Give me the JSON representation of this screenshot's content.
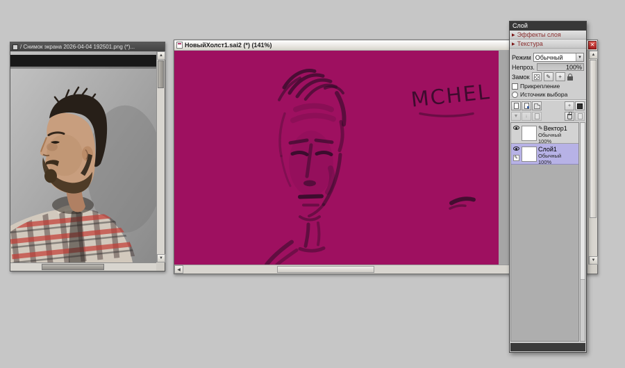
{
  "desktop": {
    "bg_color": "#c6c6c6"
  },
  "icons": {
    "close": "✕",
    "up": "▲",
    "down": "▼",
    "left": "◀",
    "right": "▶",
    "expander": "▶",
    "dropdown": "▼",
    "pen": "✎",
    "move": "+",
    "merge_down": "▼",
    "transfer_down": "↓"
  },
  "reference_window": {
    "title": "/ Снимок экрана 2026-04-04 192501.png (*)..."
  },
  "canvas_window": {
    "title": "НовыйХолст1.sai2 (*) (141%)",
    "zoom": "141%",
    "canvas_color": "#9e1060",
    "sketch_text": "MCHEL"
  },
  "layer_panel": {
    "title": "Слой",
    "sections": [
      {
        "label": "Эффекты слоя"
      },
      {
        "label": "Текстура"
      }
    ],
    "mode": {
      "label": "Режим",
      "value": "Обычный"
    },
    "opacity": {
      "label": "Непроз.",
      "value": "100%"
    },
    "lock": {
      "label": "Замок"
    },
    "clipping": {
      "label": "Прикрепление",
      "checked": false
    },
    "selection_source": {
      "label": "Источник выбора",
      "checked": false
    },
    "layers": [
      {
        "name": "Вектор1",
        "mode": "Обычный",
        "opacity": "100%",
        "selected": false,
        "type": "vector"
      },
      {
        "name": "Слой1",
        "mode": "Обычный",
        "opacity": "100%",
        "selected": true,
        "type": "raster"
      }
    ]
  }
}
